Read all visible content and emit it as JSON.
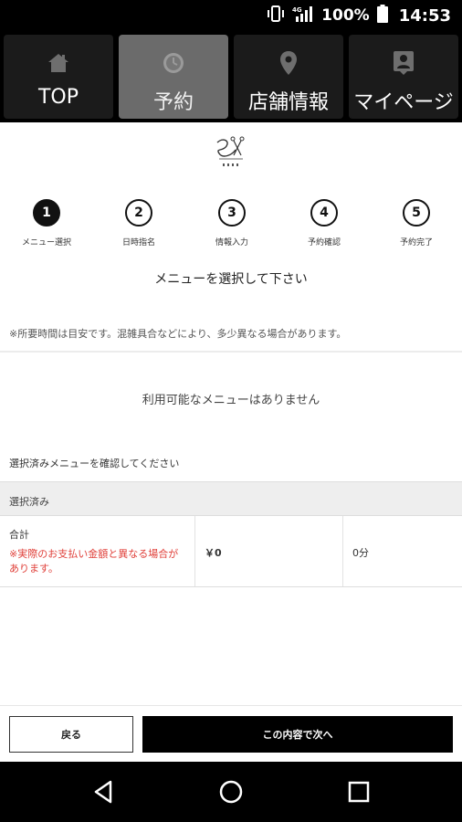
{
  "status_bar": {
    "battery_percent": "100%",
    "time": "14:53",
    "network": "4G",
    "icons": [
      "vibrate-icon",
      "signal-icon",
      "battery-icon"
    ]
  },
  "nav": {
    "tabs": [
      {
        "label": "TOP",
        "icon": "home-icon",
        "active": false
      },
      {
        "label": "予約",
        "icon": "clock-icon",
        "active": true
      },
      {
        "label": "店舗情報",
        "icon": "map-pin-icon",
        "active": false
      },
      {
        "label": "マイページ",
        "icon": "account-icon",
        "active": false
      }
    ]
  },
  "steps": [
    {
      "number": "1",
      "label": "メニュー選択",
      "current": true
    },
    {
      "number": "2",
      "label": "日時指名",
      "current": false
    },
    {
      "number": "3",
      "label": "情報入力",
      "current": false
    },
    {
      "number": "4",
      "label": "予約確認",
      "current": false
    },
    {
      "number": "5",
      "label": "予約完了",
      "current": false
    }
  ],
  "page": {
    "heading": "メニューを選択して下さい",
    "notice": "※所要時間は目安です。混雑具合などにより、多少異なる場合があります。",
    "empty_message": "利用可能なメニューはありません",
    "confirm_heading": "選択済みメニューを確認してください",
    "selected_header": "選択済み"
  },
  "summary": {
    "total_label": "合計",
    "total_note": "※実際のお支払い金額と異なる場合があります。",
    "price": "￥0",
    "duration": "0分"
  },
  "footer": {
    "back_label": "戻る",
    "next_label": "この内容で次へ"
  },
  "colors": {
    "nav_background": "#000000",
    "active_tab": "#6b6b6b",
    "warning_text": "#e0403a",
    "primary_button": "#000000"
  }
}
